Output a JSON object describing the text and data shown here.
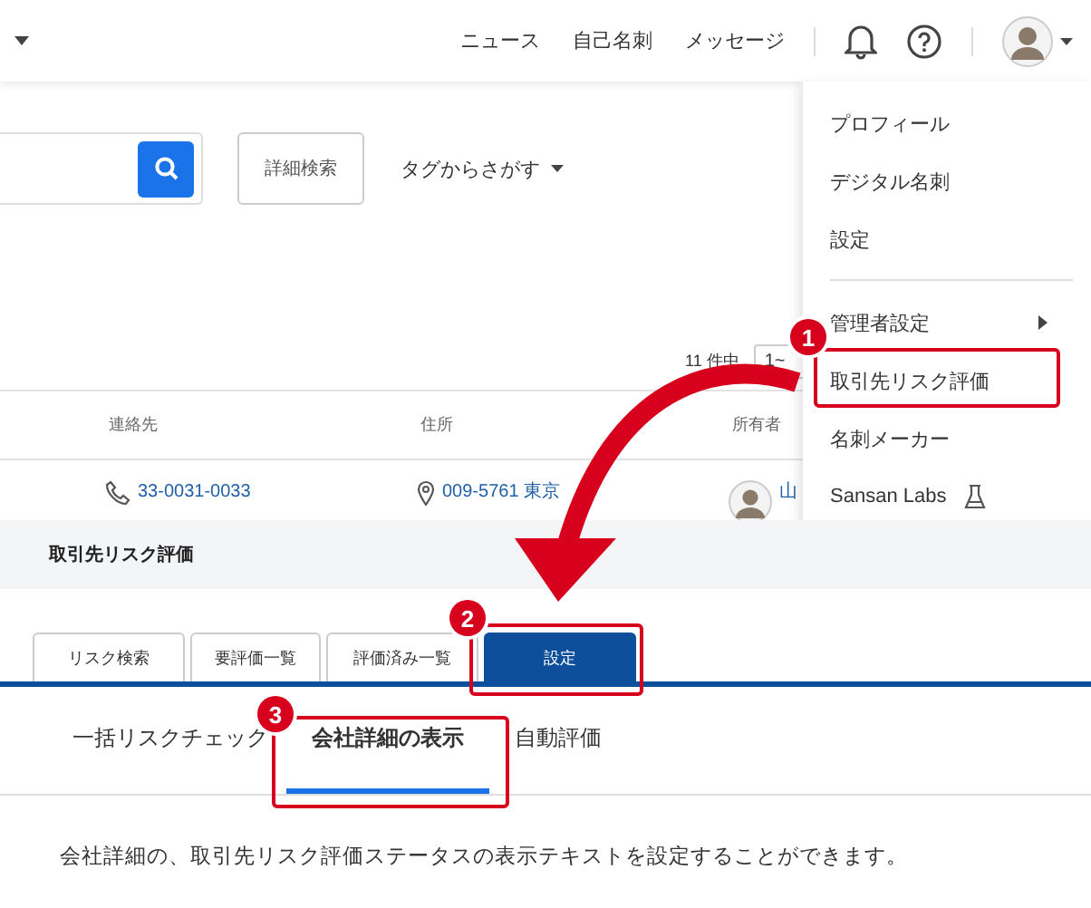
{
  "top_screen": {
    "header": {
      "nav_links": [
        "ニュース",
        "自己名刺",
        "メッセージ"
      ]
    },
    "search": {
      "advanced_button": "詳細検索",
      "tag_dropdown": "タグからさがす"
    },
    "result_count": "11 件中",
    "page_select": "1~",
    "table": {
      "columns": [
        "連絡先",
        "住所",
        "所有者"
      ],
      "rows": [
        {
          "phone": "33-0031-0033",
          "address": "009-5761 東京",
          "owner": "山"
        }
      ]
    },
    "user_menu": {
      "items": [
        {
          "label": "プロフィール",
          "kind": "plain",
          "divider_before": false
        },
        {
          "label": "デジタル名刺",
          "kind": "plain",
          "divider_before": false
        },
        {
          "label": "設定",
          "kind": "plain",
          "divider_before": false
        },
        {
          "label": "管理者設定",
          "kind": "submenu",
          "divider_before": true
        },
        {
          "label": "取引先リスク評価",
          "kind": "plain",
          "divider_before": false
        },
        {
          "label": "名刺メーカー",
          "kind": "plain",
          "divider_before": false
        },
        {
          "label": "Sansan Labs",
          "kind": "labs",
          "divider_before": false
        }
      ]
    }
  },
  "bottom_screen": {
    "title": "取引先リスク評価",
    "tabs": [
      {
        "label": "リスク検索",
        "selected": false
      },
      {
        "label": "要評価一覧",
        "selected": false
      },
      {
        "label": "評価済み一覧",
        "selected": false
      },
      {
        "label": "設定",
        "selected": true
      }
    ],
    "subtabs": [
      {
        "label": "一括リスクチェック",
        "selected": false
      },
      {
        "label": "会社詳細の表示",
        "selected": true
      },
      {
        "label": "自動評価",
        "selected": false
      }
    ],
    "description": "会社詳細の、取引先リスク評価ステータスの表示テキストを設定することができます。"
  },
  "callouts": [
    {
      "number": "1"
    },
    {
      "number": "2"
    },
    {
      "number": "3"
    }
  ]
}
